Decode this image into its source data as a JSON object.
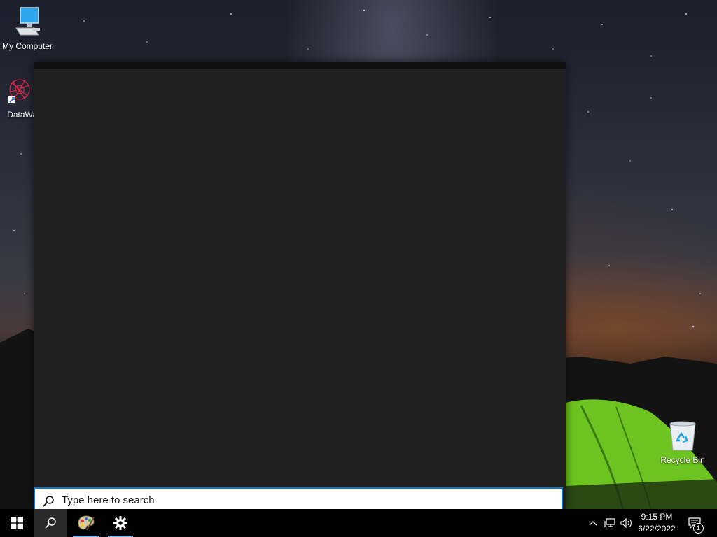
{
  "desktop": {
    "icons": [
      {
        "label": "My Computer",
        "icon": "computer-icon"
      },
      {
        "label": "DataWag",
        "icon": "datawag-app-icon"
      },
      {
        "label": "Recycle Bin",
        "icon": "recycle-bin-icon"
      }
    ]
  },
  "search": {
    "placeholder": "Type here to search",
    "value": "",
    "icon": "search-icon"
  },
  "taskbar": {
    "start_icon": "windows-logo-icon",
    "search_icon": "search-icon",
    "pinned": [
      {
        "icon": "paint-palette-icon",
        "active": false
      },
      {
        "icon": "gear-icon",
        "active": false
      }
    ],
    "tray": {
      "icons": [
        "chevron-up-icon",
        "network-icon",
        "volume-icon"
      ],
      "time": "9:15 PM",
      "date": "6/22/2022",
      "notification_count": "1"
    }
  },
  "colors": {
    "panel": "#202020",
    "accent": "#0078d7",
    "taskbar": "#000000",
    "taskbar_underline": "#76b9ed"
  }
}
